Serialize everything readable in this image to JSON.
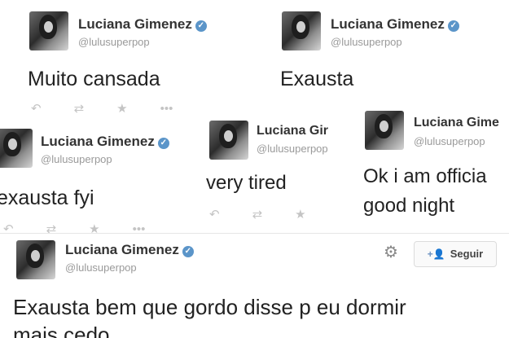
{
  "tweets": [
    {
      "name": "Luciana Gimenez",
      "handle": "@lulusuperpop",
      "text": "Muito cansada"
    },
    {
      "name": "Luciana Gimenez",
      "handle": "@lulusuperpop",
      "text": "Exausta"
    },
    {
      "name": "Luciana Gimenez",
      "handle": "@lulusuperpop",
      "text": "exausta fyi"
    },
    {
      "name": "Luciana Gir",
      "handle": "@lulusuperpop",
      "text": "very tired"
    },
    {
      "name": "Luciana Gime",
      "handle": "@lulusuperpop",
      "text_line1": "Ok i am officia",
      "text_line2": "good night"
    },
    {
      "name": "Luciana Gimenez",
      "handle": "@lulusuperpop",
      "text_line1": "Exausta bem que gordo disse p eu dormir",
      "text_line2": "mais cedo",
      "follow_label": "Seguir"
    }
  ],
  "icons": {
    "reply": "reply-icon",
    "retweet": "retweet-icon",
    "favorite": "star-icon",
    "more": "more-icon",
    "verified": "verified-badge-icon",
    "settings": "gear-icon",
    "follow": "follow-plus-icon"
  },
  "colors": {
    "verified": "#5b95c9",
    "handle": "#9a9a9a",
    "action_icons": "#c4c4c4"
  }
}
